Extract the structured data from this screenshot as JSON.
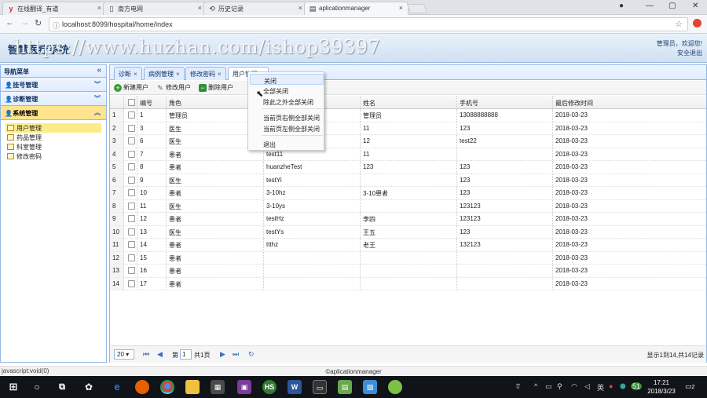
{
  "browser": {
    "tabs": [
      {
        "label": "在线翻译_有道",
        "icon": "youdao-icon"
      },
      {
        "label": "南方电网",
        "icon": "page-icon"
      },
      {
        "label": "历史记录",
        "icon": "history-icon"
      },
      {
        "label": "aplicationmanager",
        "icon": "page-icon"
      }
    ],
    "url": "localhost:8099/hospital/home/index"
  },
  "app": {
    "title": "智慧医疗系统",
    "watermark": "https://www.huzhan.com/ishop39397",
    "user_line1": "管理员，欢迎您!",
    "user_line2": "安全退出"
  },
  "sidebar": {
    "title": "导航菜单",
    "sections": [
      {
        "label": "挂号管理"
      },
      {
        "label": "诊断管理"
      },
      {
        "label": "系统管理"
      }
    ],
    "tree": [
      {
        "label": "用户管理"
      },
      {
        "label": "药品管理"
      },
      {
        "label": "科室管理"
      },
      {
        "label": "修改密码"
      }
    ]
  },
  "page_tabs": [
    {
      "label": "诊断"
    },
    {
      "label": "病例管理"
    },
    {
      "label": "修改密码"
    },
    {
      "label": "用户管理"
    }
  ],
  "toolbar": {
    "add": "新建用户",
    "edit": "修改用户",
    "delete": "删除用户"
  },
  "grid": {
    "columns": [
      "编号",
      "角色",
      "",
      "姓名",
      "手机号",
      "最后修改时间"
    ],
    "rows": [
      {
        "n": "1",
        "id": "1",
        "role": "管理员",
        "user": "",
        "name": "管理员",
        "phone": "13088888888",
        "time": "2018-03-23"
      },
      {
        "n": "2",
        "id": "3",
        "role": "医生",
        "user": "",
        "name": "11",
        "phone": "123",
        "time": "2018-03-23"
      },
      {
        "n": "3",
        "id": "6",
        "role": "医生",
        "user": "",
        "name": "12",
        "phone": "test22",
        "time": "2018-03-23"
      },
      {
        "n": "4",
        "id": "7",
        "role": "患者",
        "user": "test11",
        "name": "11",
        "phone": "",
        "time": "2018-03-23"
      },
      {
        "n": "5",
        "id": "8",
        "role": "患者",
        "user": "huanzheTest",
        "name": "123",
        "phone": "123",
        "time": "2018-03-23"
      },
      {
        "n": "6",
        "id": "9",
        "role": "医生",
        "user": "testYi",
        "name": "",
        "phone": "123",
        "time": "2018-03-23"
      },
      {
        "n": "7",
        "id": "10",
        "role": "患者",
        "user": "3-10hz",
        "name": "3-10患者",
        "phone": "123",
        "time": "2018-03-23"
      },
      {
        "n": "8",
        "id": "11",
        "role": "医生",
        "user": "3-10ys",
        "name": "",
        "phone": "123123",
        "time": "2018-03-23"
      },
      {
        "n": "9",
        "id": "12",
        "role": "患者",
        "user": "testHz",
        "name": "李四",
        "phone": "123123",
        "time": "2018-03-23"
      },
      {
        "n": "10",
        "id": "13",
        "role": "医生",
        "user": "testYs",
        "name": "王五",
        "phone": "123",
        "time": "2018-03-23"
      },
      {
        "n": "11",
        "id": "14",
        "role": "患者",
        "user": "ttthz",
        "name": "老王",
        "phone": "132123",
        "time": "2018-03-23"
      },
      {
        "n": "12",
        "id": "15",
        "role": "患者",
        "user": "",
        "name": "",
        "phone": "",
        "time": "2018-03-23"
      },
      {
        "n": "13",
        "id": "16",
        "role": "患者",
        "user": "",
        "name": "",
        "phone": "",
        "time": "2018-03-23"
      },
      {
        "n": "14",
        "id": "17",
        "role": "患者",
        "user": "",
        "name": "",
        "phone": "",
        "time": "2018-03-23"
      }
    ]
  },
  "pager": {
    "page_size": "20",
    "page_prefix": "第",
    "page_value": "1",
    "page_suffix": "共1页",
    "info": "显示1到14,共14记录"
  },
  "context_menu": {
    "items": [
      "关闭",
      "全部关闭",
      "除此之外全部关闭",
      "当前页右侧全部关闭",
      "当前页左侧全部关闭",
      "退出"
    ]
  },
  "status": {
    "left": "javascript:void(0)",
    "footer": "©aplicationmanager"
  },
  "taskbar": {
    "time": "17:21",
    "date": "2018/3/23",
    "ime": "英",
    "notify_count": "2"
  }
}
